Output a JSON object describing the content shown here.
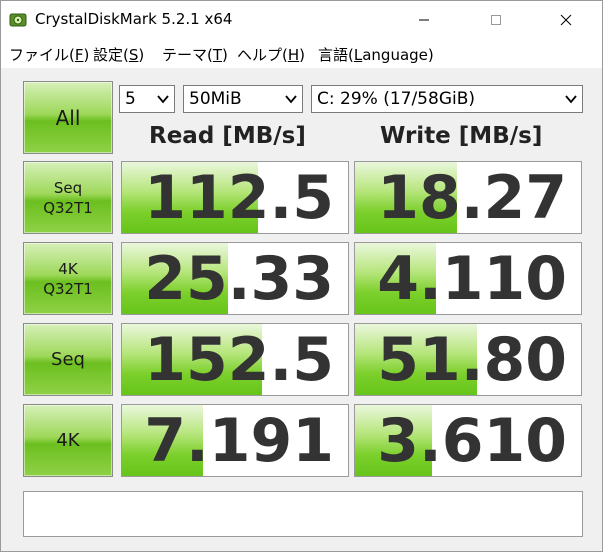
{
  "window": {
    "title": "CrystalDiskMark 5.2.1 x64"
  },
  "menu": [
    {
      "prefix": "ファイル(",
      "key": "F",
      "suffix": ")"
    },
    {
      "prefix": "設定(",
      "key": "S",
      "suffix": ")"
    },
    {
      "prefix": "テーマ(",
      "key": "T",
      "suffix": ")"
    },
    {
      "prefix": "ヘルプ(",
      "key": "H",
      "suffix": ")"
    },
    {
      "prefix": "言語(",
      "key": "L",
      "suffix": "anguage)"
    }
  ],
  "controls": {
    "all_label": "All",
    "count_value": "5",
    "size_value": "50MiB",
    "drive_value": "C: 29% (17/58GiB)"
  },
  "headers": {
    "read": "Read [MB/s]",
    "write": "Write [MB/s]"
  },
  "tests": [
    {
      "line1": "Seq",
      "line2": "Q32T1",
      "read": "112.5",
      "write": "18.27",
      "read_fill": 0.6,
      "write_fill": 0.45
    },
    {
      "line1": "4K",
      "line2": "Q32T1",
      "read": "25.33",
      "write": "4.110",
      "read_fill": 0.47,
      "write_fill": 0.36
    },
    {
      "line1": "Seq",
      "line2": "",
      "read": "152.5",
      "write": "51.80",
      "read_fill": 0.62,
      "write_fill": 0.54
    },
    {
      "line1": "4K",
      "line2": "",
      "read": "7.191",
      "write": "3.610",
      "read_fill": 0.36,
      "write_fill": 0.34
    }
  ],
  "colors": {
    "button_green": "#7cd02c",
    "bar_green": "#66c41a",
    "value_text": "#333333"
  }
}
